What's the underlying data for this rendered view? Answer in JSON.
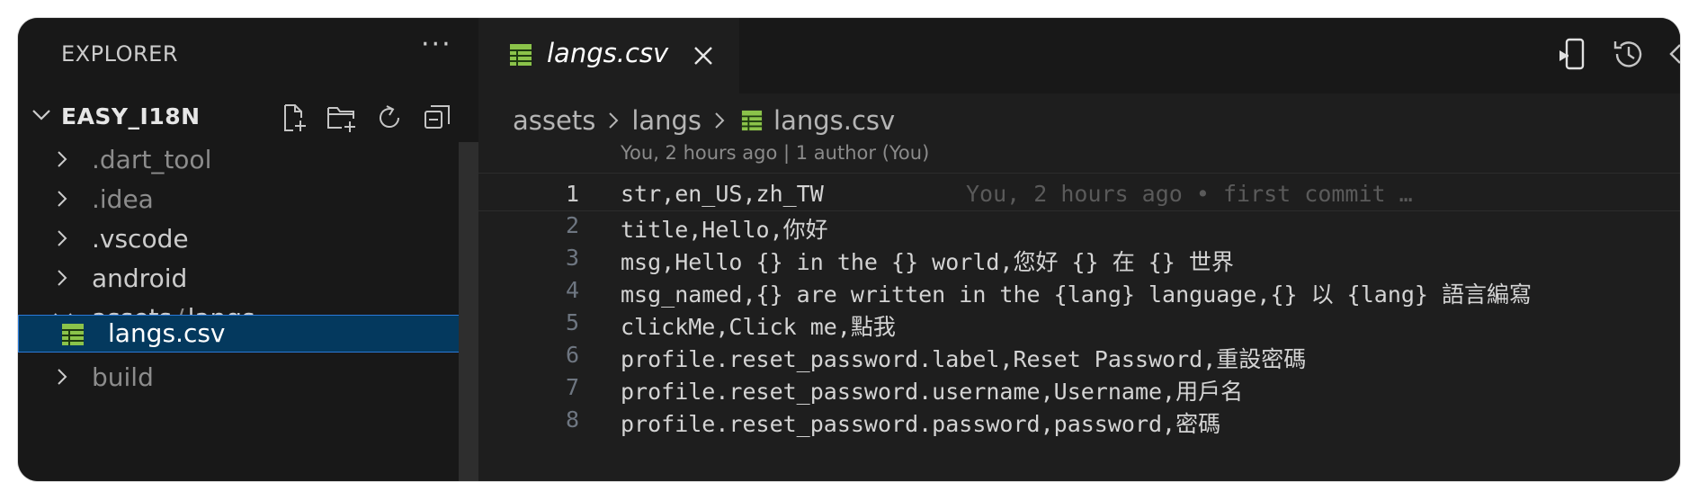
{
  "sidebar": {
    "title": "EXPLORER",
    "more": "···",
    "project": "EASY_I18N",
    "tree": [
      {
        "label": ".dart_tool",
        "dim": true,
        "expanded": false
      },
      {
        "label": ".idea",
        "dim": true,
        "expanded": false
      },
      {
        "label": ".vscode",
        "dim": false,
        "expanded": false
      },
      {
        "label": "android",
        "dim": false,
        "expanded": false
      },
      {
        "label_main": "assets",
        "label_sep": "/",
        "label_sub": "langs",
        "expanded": true
      },
      {
        "label": "langs.csv",
        "selected": true,
        "icon": "table-file-icon"
      },
      {
        "label": "build",
        "dim": true,
        "expanded": false
      }
    ]
  },
  "editor": {
    "tab": {
      "label": "langs.csv",
      "icon": "table-file-icon"
    },
    "breadcrumb": [
      "assets",
      "langs",
      "langs.csv"
    ],
    "blame_header": "You, 2 hours ago | 1 author (You)",
    "inline_blame": "You, 2 hours ago • first commit …",
    "lines": [
      {
        "n": "1",
        "text": "str,en_US,zh_TW"
      },
      {
        "n": "2",
        "text": "title,Hello,你好"
      },
      {
        "n": "3",
        "text": "msg,Hello {} in the {} world,您好 {} 在 {} 世界"
      },
      {
        "n": "4",
        "text": "msg_named,{} are written in the {lang} language,{} 以 {lang} 語言編寫"
      },
      {
        "n": "5",
        "text": "clickMe,Click me,點我"
      },
      {
        "n": "6",
        "text": "profile.reset_password.label,Reset Password,重設密碼"
      },
      {
        "n": "7",
        "text": "profile.reset_password.username,Username,用戶名"
      },
      {
        "n": "8",
        "text": "profile.reset_password.password,password,密碼"
      }
    ]
  },
  "colors": {
    "csv_icon": "#8bc34a",
    "selection": "#04395e",
    "focus_border": "#2b79d8"
  }
}
